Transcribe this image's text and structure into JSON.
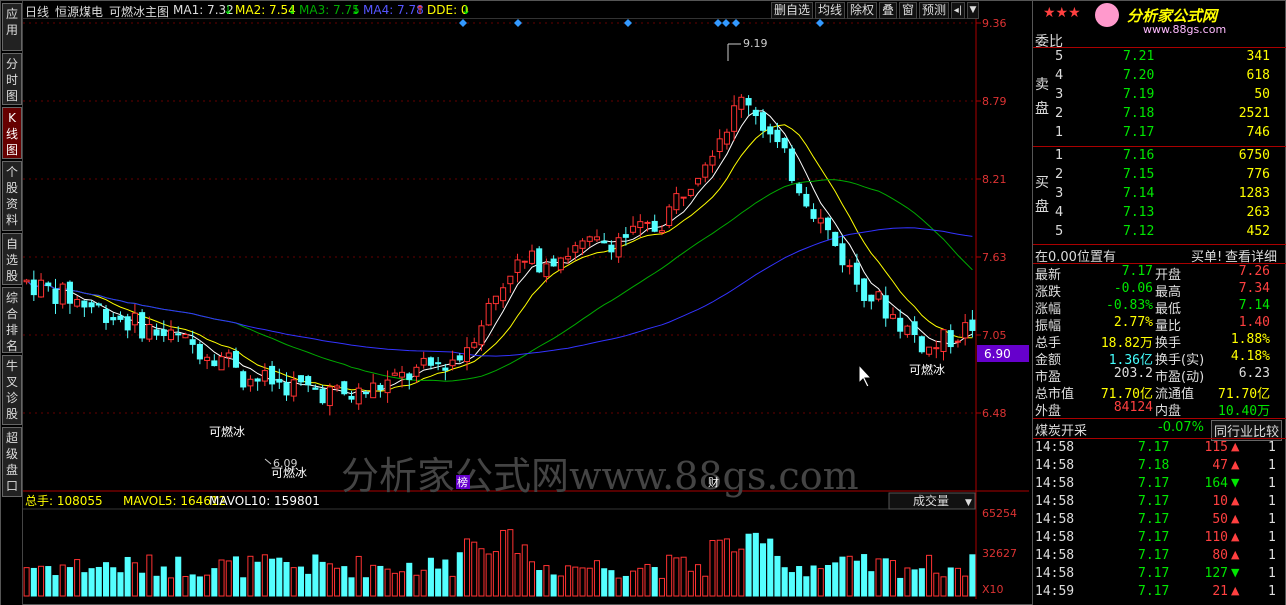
{
  "sidebar": {
    "items": [
      "应用",
      "分时图",
      "K线图",
      "个股资料",
      "自选股",
      "综合排名",
      "牛叉诊股",
      "超级盘口"
    ],
    "active_index": 2
  },
  "topbar": {
    "period": "日线",
    "stock": "恒源煤电",
    "indicator": "可燃冰主图",
    "ma1": "MA1: 7.32",
    "ma2": "MA2: 7.54",
    "ma3": "MA3: 7.75",
    "ma4": "MA4: 7.78",
    "dde": "DDE: 0",
    "buttons": [
      "删自选",
      "均线",
      "除权",
      "叠",
      "窗",
      "预测"
    ],
    "arrow_up": "↓",
    "arrow_dn": "↑"
  },
  "price_axis": [
    "9.36",
    "8.79",
    "8.21",
    "7.63",
    "7.05",
    "6.48"
  ],
  "current_price_tag": "6.90",
  "high_label": "9.19",
  "low_label": "6.09",
  "signal_labels": [
    "可燃冰",
    "可燃冰",
    "可燃冰"
  ],
  "markers": {
    "bang": "榜",
    "cai": "财"
  },
  "watermark": "分析家公式网www.88gs.com",
  "volume": {
    "label": "总手: 108055",
    "mavol5": "MAVOL5: 164612",
    "mavol10": "MAVOL10: 159801",
    "dropdown": "成交量",
    "axis": [
      "65254",
      "32627",
      "X10"
    ]
  },
  "colors": {
    "up": "#ff3232",
    "down": "#54ffff",
    "ma1": "#ffffff",
    "ma2": "#ffff00",
    "ma3": "#00aa00",
    "ma4": "#3333ff"
  },
  "right_panel": {
    "stars": "★★★",
    "logo_text": "分析家公式网",
    "logo_url": "www.88gs.com",
    "weibi_label": "委比",
    "sell_label": "卖盘",
    "buy_label": "买盘",
    "sell": [
      {
        "n": "5",
        "price": "7.21",
        "vol": "341"
      },
      {
        "n": "4",
        "price": "7.20",
        "vol": "618"
      },
      {
        "n": "3",
        "price": "7.19",
        "vol": "50"
      },
      {
        "n": "2",
        "price": "7.18",
        "vol": "2521"
      },
      {
        "n": "1",
        "price": "7.17",
        "vol": "746"
      }
    ],
    "buy": [
      {
        "n": "1",
        "price": "7.16",
        "vol": "6750"
      },
      {
        "n": "2",
        "price": "7.15",
        "vol": "776"
      },
      {
        "n": "3",
        "price": "7.14",
        "vol": "1283"
      },
      {
        "n": "4",
        "price": "7.13",
        "vol": "263"
      },
      {
        "n": "5",
        "price": "7.12",
        "vol": "452"
      }
    ],
    "position_text": "在0.00位置有",
    "buy_link": "买单!",
    "detail_link": "查看详细",
    "stats": [
      {
        "l1": "最新",
        "v1": "7.17",
        "l2": "开盘",
        "v2": "7.26",
        "c1": "green",
        "c2": "red"
      },
      {
        "l1": "涨跌",
        "v1": "-0.06",
        "l2": "最高",
        "v2": "7.34",
        "c1": "green",
        "c2": "red"
      },
      {
        "l1": "涨幅",
        "v1": "-0.83%",
        "l2": "最低",
        "v2": "7.14",
        "c1": "green",
        "c2": "green"
      },
      {
        "l1": "振幅",
        "v1": "2.77%",
        "l2": "量比",
        "v2": "1.40",
        "c1": "yellow",
        "c2": "red"
      },
      {
        "l1": "总手",
        "v1": "18.82万",
        "l2": "换手",
        "v2": "1.88%",
        "c1": "yellow",
        "c2": "yellow"
      },
      {
        "l1": "金额",
        "v1": "1.36亿",
        "l2": "换手(实)",
        "v2": "4.18%",
        "c1": "cyan",
        "c2": "yellow"
      },
      {
        "l1": "市盈",
        "v1": "203.2",
        "l2": "市盈(动)",
        "v2": "6.23",
        "c1": "white",
        "c2": "white"
      },
      {
        "l1": "总市值",
        "v1": "71.70亿",
        "l2": "流通值",
        "v2": "71.70亿",
        "c1": "yellow",
        "c2": "yellow"
      },
      {
        "l1": "外盘",
        "v1": "84124",
        "l2": "内盘",
        "v2": "10.40万",
        "c1": "red",
        "c2": "green"
      }
    ],
    "industry": "煤炭开采",
    "industry_chg": "-0.07%",
    "industry_btn": "同行业比较",
    "ticks": [
      {
        "t": "14:58",
        "p": "7.17",
        "v": "115",
        "d": "up",
        "pc": "green"
      },
      {
        "t": "14:58",
        "p": "7.18",
        "v": "47",
        "d": "up",
        "pc": "green"
      },
      {
        "t": "14:58",
        "p": "7.17",
        "v": "164",
        "d": "down",
        "pc": "green"
      },
      {
        "t": "14:58",
        "p": "7.17",
        "v": "10",
        "d": "up",
        "pc": "green"
      },
      {
        "t": "14:58",
        "p": "7.17",
        "v": "50",
        "d": "up",
        "pc": "green"
      },
      {
        "t": "14:58",
        "p": "7.17",
        "v": "110",
        "d": "up",
        "pc": "green"
      },
      {
        "t": "14:58",
        "p": "7.17",
        "v": "80",
        "d": "up",
        "pc": "green"
      },
      {
        "t": "14:58",
        "p": "7.17",
        "v": "127",
        "d": "down",
        "pc": "green"
      },
      {
        "t": "14:59",
        "p": "7.17",
        "v": "21",
        "d": "up",
        "pc": "green"
      }
    ],
    "tick_flags": [
      "1",
      "1",
      "1",
      "1",
      "1",
      "1",
      "1",
      "1",
      "1"
    ]
  }
}
